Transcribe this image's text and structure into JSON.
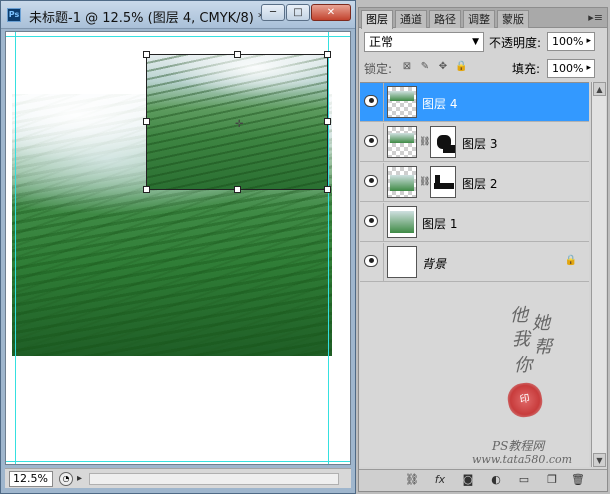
{
  "document": {
    "app_icon": "Ps",
    "title": "未标题-1 @ 12.5% (图层 4, CMYK/8) *",
    "zoom": "12.5%",
    "window_buttons": {
      "minimize": "─",
      "restore": "□",
      "close": "✕"
    }
  },
  "layers_panel": {
    "tabs": [
      "图层",
      "通道",
      "路径",
      "调整",
      "蒙版"
    ],
    "active_tab": "图层",
    "menu_icon": "▸≡",
    "blend_mode": "正常",
    "opacity_label": "不透明度:",
    "opacity_value": "100%",
    "lock_label": "锁定:",
    "fill_label": "填充:",
    "fill_value": "100%",
    "layers": [
      {
        "name": "图层 4",
        "selected": true,
        "mask": false
      },
      {
        "name": "图层 3",
        "selected": false,
        "mask": true
      },
      {
        "name": "图层 2",
        "selected": false,
        "mask": true
      },
      {
        "name": "图层 1",
        "selected": false,
        "mask": false
      },
      {
        "name": "背景",
        "selected": false,
        "mask": false,
        "locked": true
      }
    ],
    "footer_icons": [
      "link-icon",
      "fx-icon",
      "mask-icon",
      "adjustment-icon",
      "group-icon",
      "new-layer-icon",
      "trash-icon"
    ]
  },
  "watermark": {
    "line1": "他",
    "line2": "她",
    "line3": "我",
    "line4": "帮",
    "line5": "你",
    "site_label": "PS教程网",
    "url": "www.tata580.com"
  },
  "colors": {
    "selection": "#3399ff",
    "guide": "#35e0e0",
    "close_button": "#c2432e"
  }
}
